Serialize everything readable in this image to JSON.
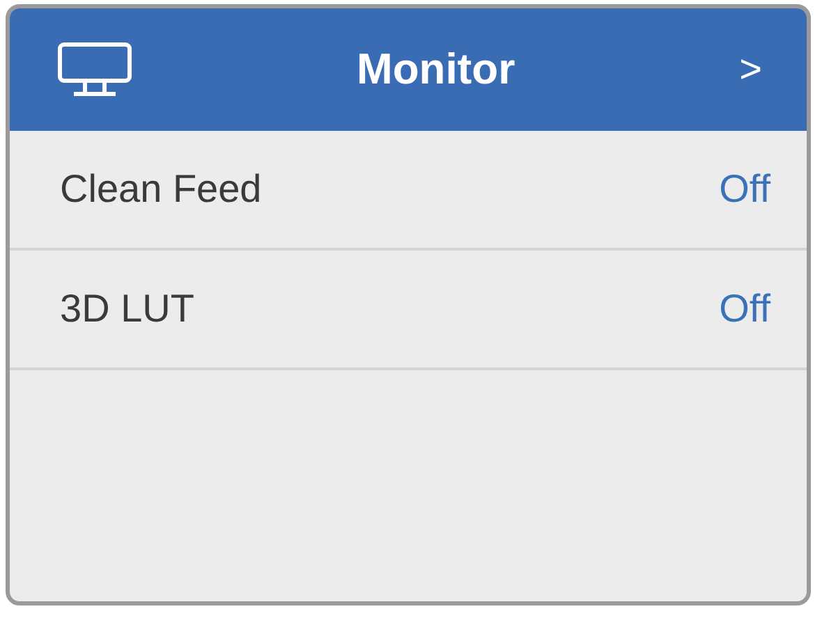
{
  "header": {
    "title": "Monitor",
    "arrow": ">"
  },
  "rows": [
    {
      "label": "Clean Feed",
      "value": "Off"
    },
    {
      "label": "3D LUT",
      "value": "Off"
    }
  ]
}
